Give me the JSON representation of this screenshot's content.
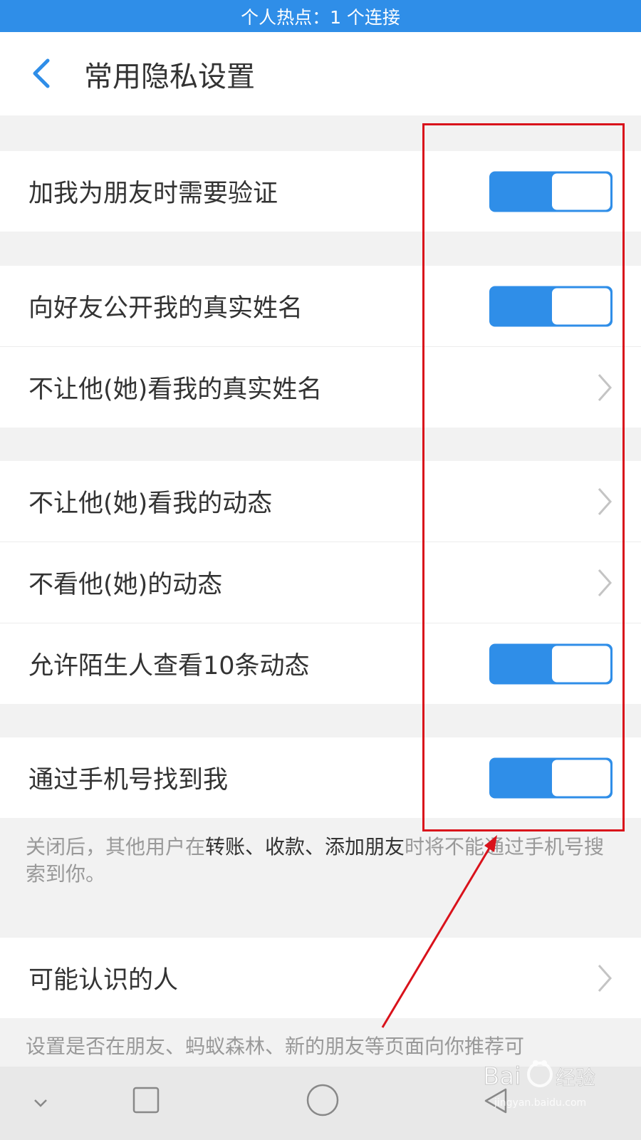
{
  "status_bar": {
    "text": "个人热点：1 个连接"
  },
  "header": {
    "title": "常用隐私设置",
    "back_icon": "chevron-left-icon"
  },
  "groups": [
    {
      "items": [
        {
          "label": "加我为朋友时需要验证",
          "control": "toggle",
          "on": true
        }
      ]
    },
    {
      "items": [
        {
          "label": "向好友公开我的真实姓名",
          "control": "toggle",
          "on": true
        },
        {
          "label": "不让他(她)看我的真实姓名",
          "control": "chevron"
        }
      ]
    },
    {
      "items": [
        {
          "label": "不让他(她)看我的动态",
          "control": "chevron"
        },
        {
          "label": "不看他(她)的动态",
          "control": "chevron"
        },
        {
          "label": "允许陌生人查看10条动态",
          "control": "toggle",
          "on": true
        }
      ]
    },
    {
      "items": [
        {
          "label": "通过手机号找到我",
          "control": "toggle",
          "on": true
        }
      ]
    },
    {
      "items": [
        {
          "label": "可能认识的人",
          "control": "chevron"
        }
      ]
    }
  ],
  "footnotes": {
    "phone": {
      "part1": "关闭后，其他用户在",
      "highlight": "转账、收款、添加朋友",
      "part2": "时将不能通过手机号搜索到你。"
    },
    "people": "设置是否在朋友、蚂蚁森林、新的朋友等页面向你推荐可"
  },
  "nav_bar": {
    "buttons": [
      "chevron-down-icon",
      "square-icon",
      "circle-icon",
      "back-triangle-icon"
    ]
  },
  "watermark": {
    "brand": "Bai 经验",
    "url": "jingyan.baidu.com"
  },
  "colors": {
    "accent": "#2f8ee8",
    "annotation": "#d9121b",
    "background": "#f2f2f2"
  }
}
